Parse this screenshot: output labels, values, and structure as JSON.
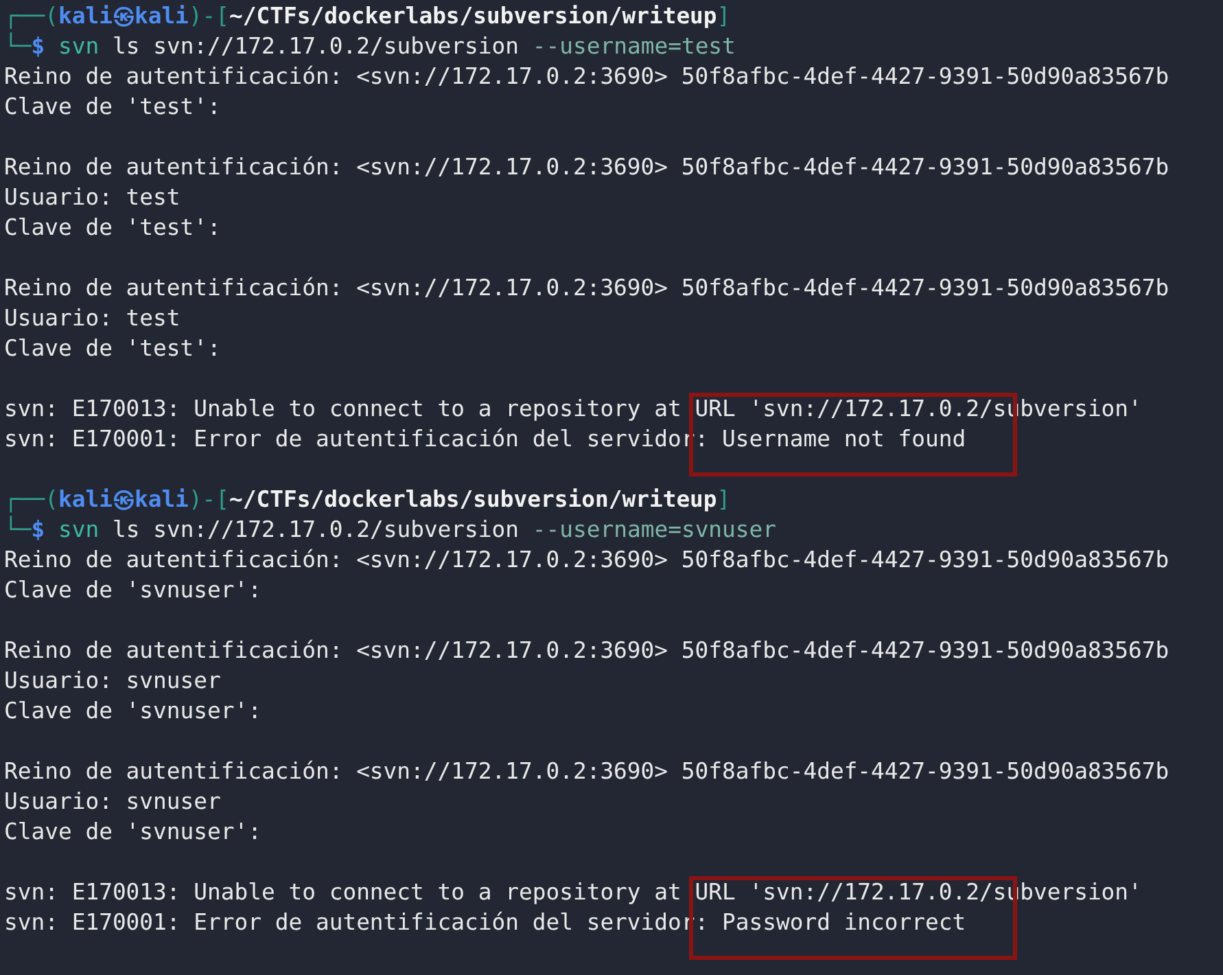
{
  "terminal": {
    "sessions": [
      {
        "prompt": [
          {
            "kind": "frame",
            "text": "┌──("
          },
          {
            "kind": "user",
            "text": "kali㉿kali"
          },
          {
            "kind": "frame",
            "text": ")-["
          },
          {
            "kind": "path",
            "text": "~/CTFs/dockerlabs/subversion/writeup"
          },
          {
            "kind": "frame",
            "text": "]"
          }
        ],
        "command": [
          {
            "kind": "frame",
            "text": "└─"
          },
          {
            "kind": "user",
            "text": "$"
          },
          {
            "kind": "program",
            "text": " svn"
          },
          {
            "kind": "plain",
            "text": " ls svn://172.17.0.2/subversion"
          },
          {
            "kind": "option",
            "text": " --username=test"
          }
        ],
        "output": [
          {
            "kind": "text",
            "text": "Reino de autentificación: <svn://172.17.0.2:3690> 50f8afbc-4def-4427-9391-50d90a83567b"
          },
          {
            "kind": "text",
            "text": "Clave de 'test':"
          },
          {
            "kind": "blank"
          },
          {
            "kind": "text",
            "text": "Reino de autentificación: <svn://172.17.0.2:3690> 50f8afbc-4def-4427-9391-50d90a83567b"
          },
          {
            "kind": "text",
            "text": "Usuario: test"
          },
          {
            "kind": "text",
            "text": "Clave de 'test':"
          },
          {
            "kind": "blank"
          },
          {
            "kind": "text",
            "text": "Reino de autentificación: <svn://172.17.0.2:3690> 50f8afbc-4def-4427-9391-50d90a83567b"
          },
          {
            "kind": "text",
            "text": "Usuario: test"
          },
          {
            "kind": "text",
            "text": "Clave de 'test':"
          },
          {
            "kind": "blank"
          }
        ],
        "errors": {
          "highlighted": true,
          "lines": [
            "svn: E170013: Unable to connect to a repository at URL 'svn://172.17.0.2/subversion'",
            "svn: E170001: Error de autentificación del servidor: Username not found"
          ]
        }
      },
      {
        "prompt": [
          {
            "kind": "frame",
            "text": "┌──("
          },
          {
            "kind": "user",
            "text": "kali㉿kali"
          },
          {
            "kind": "frame",
            "text": ")-["
          },
          {
            "kind": "path",
            "text": "~/CTFs/dockerlabs/subversion/writeup"
          },
          {
            "kind": "frame",
            "text": "]"
          }
        ],
        "command": [
          {
            "kind": "frame",
            "text": "└─"
          },
          {
            "kind": "user",
            "text": "$"
          },
          {
            "kind": "program",
            "text": " svn"
          },
          {
            "kind": "plain",
            "text": " ls svn://172.17.0.2/subversion"
          },
          {
            "kind": "option",
            "text": " --username=svnuser"
          }
        ],
        "output": [
          {
            "kind": "text",
            "text": "Reino de autentificación: <svn://172.17.0.2:3690> 50f8afbc-4def-4427-9391-50d90a83567b"
          },
          {
            "kind": "text",
            "text": "Clave de 'svnuser':"
          },
          {
            "kind": "blank"
          },
          {
            "kind": "text",
            "text": "Reino de autentificación: <svn://172.17.0.2:3690> 50f8afbc-4def-4427-9391-50d90a83567b"
          },
          {
            "kind": "text",
            "text": "Usuario: svnuser"
          },
          {
            "kind": "text",
            "text": "Clave de 'svnuser':"
          },
          {
            "kind": "blank"
          },
          {
            "kind": "text",
            "text": "Reino de autentificación: <svn://172.17.0.2:3690> 50f8afbc-4def-4427-9391-50d90a83567b"
          },
          {
            "kind": "text",
            "text": "Usuario: svnuser"
          },
          {
            "kind": "text",
            "text": "Clave de 'svnuser':"
          },
          {
            "kind": "blank"
          }
        ],
        "errors": {
          "highlighted": true,
          "lines": [
            "svn: E170013: Unable to connect to a repository at URL 'svn://172.17.0.2/subversion'",
            "svn: E170001: Error de autentificación del servidor: Password incorrect"
          ]
        }
      }
    ]
  }
}
